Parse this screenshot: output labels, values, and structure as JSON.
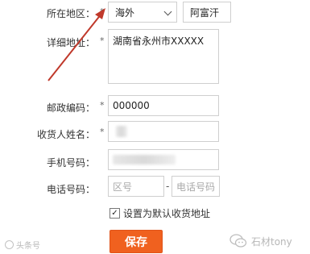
{
  "form": {
    "region": {
      "label": "所在地区：",
      "required": "*",
      "country_value": "海外",
      "city_value": "阿富汗"
    },
    "address": {
      "label": "详细地址：",
      "required": "*",
      "value": "湖南省永州市XXXXX"
    },
    "postcode": {
      "label": "邮政编码：",
      "required": "*",
      "value": "000000"
    },
    "recipient": {
      "label": "收货人姓名：",
      "required": "*"
    },
    "mobile": {
      "label": "手机号码："
    },
    "phone": {
      "label": "电话号码：",
      "area_placeholder": "区号",
      "separator": "-",
      "number_placeholder": "电话号码"
    },
    "default_checkbox": {
      "checked": true,
      "mark": "✓",
      "label": "设置为默认收货地址"
    },
    "save_label": "保存"
  },
  "annotation": {
    "arrow_color": "#c0392b"
  },
  "watermark": {
    "left_text": "头条号",
    "right_text": "石材tony"
  },
  "colors": {
    "save_button": "#f0611f",
    "input_border": "#cfcfcf"
  }
}
